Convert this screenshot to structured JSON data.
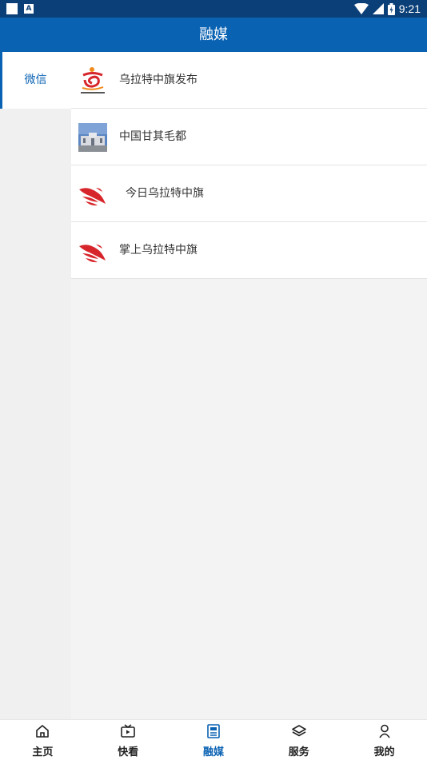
{
  "status_bar": {
    "time": "9:21"
  },
  "header": {
    "title": "融媒"
  },
  "sidebar": {
    "items": [
      {
        "label": "微信",
        "active": true
      }
    ]
  },
  "accounts": [
    {
      "name": "乌拉特中旗发布",
      "logo": "red-orange-swirl-logo"
    },
    {
      "name": "中国甘其毛都",
      "logo": "building-photo-logo"
    },
    {
      "name": "今日乌拉特中旗",
      "logo": "red-swallow-logo"
    },
    {
      "name": "掌上乌拉特中旗",
      "logo": "red-swallow-logo"
    }
  ],
  "tabs": [
    {
      "label": "主页",
      "icon": "home-icon"
    },
    {
      "label": "快看",
      "icon": "tv-icon"
    },
    {
      "label": "融媒",
      "icon": "newspaper-icon",
      "active": true
    },
    {
      "label": "服务",
      "icon": "layers-icon"
    },
    {
      "label": "我的",
      "icon": "user-icon"
    }
  ],
  "colors": {
    "primary": "#0a62b3",
    "statusbar": "#0b3f77",
    "logo_red": "#d7262b"
  }
}
